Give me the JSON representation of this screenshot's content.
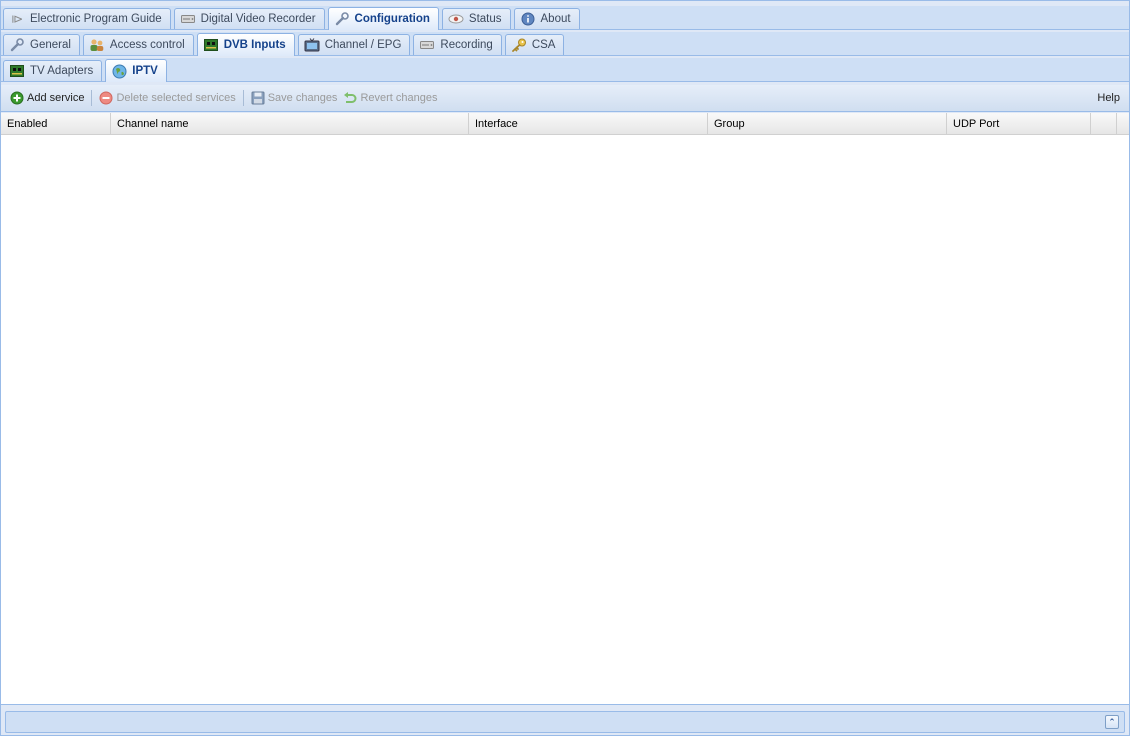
{
  "main_tabs": [
    {
      "label": "Electronic Program Guide",
      "icon": "tag-icon"
    },
    {
      "label": "Digital Video Recorder",
      "icon": "recorder-icon"
    },
    {
      "label": "Configuration",
      "icon": "wrench-icon",
      "active": true
    },
    {
      "label": "Status",
      "icon": "eye-icon"
    },
    {
      "label": "About",
      "icon": "info-icon"
    }
  ],
  "config_tabs": [
    {
      "label": "General",
      "icon": "wrench-icon"
    },
    {
      "label": "Access control",
      "icon": "users-icon"
    },
    {
      "label": "DVB Inputs",
      "icon": "card-icon",
      "active": true
    },
    {
      "label": "Channel / EPG",
      "icon": "tv-icon"
    },
    {
      "label": "Recording",
      "icon": "recorder-icon"
    },
    {
      "label": "CSA",
      "icon": "key-icon"
    }
  ],
  "input_tabs": [
    {
      "label": "TV Adapters",
      "icon": "card-icon"
    },
    {
      "label": "IPTV",
      "icon": "globe-icon",
      "active": true
    }
  ],
  "toolbar": {
    "add_service": "Add service",
    "delete_selected": "Delete selected services",
    "save_changes": "Save changes",
    "revert_changes": "Revert changes",
    "help": "Help"
  },
  "grid": {
    "columns": [
      "Enabled",
      "Channel name",
      "Interface",
      "Group",
      "UDP Port"
    ],
    "rows": []
  },
  "colors": {
    "accent": "#15428b",
    "panel_bg": "#dfe8f6",
    "border": "#99bbe8",
    "add_green": "#3a9a2e",
    "delete_red": "#e05a4f"
  }
}
